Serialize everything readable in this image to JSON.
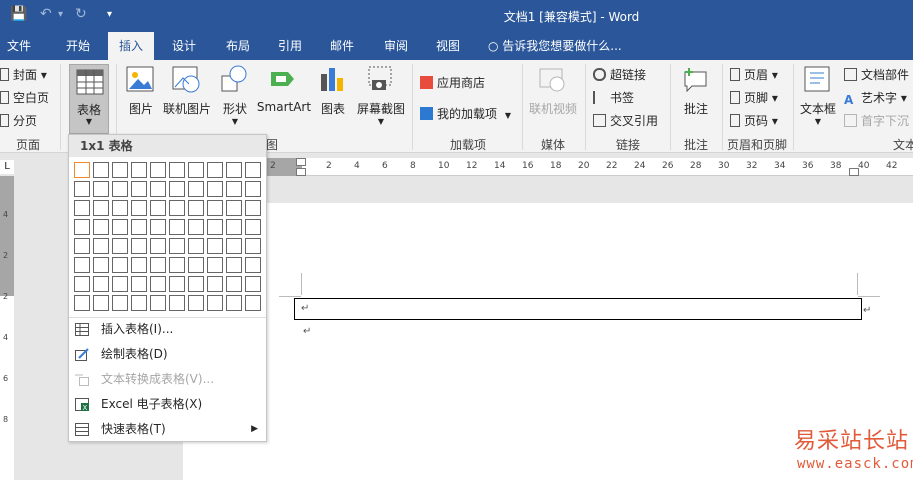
{
  "titlebar": {
    "title": "文档1 [兼容模式] - Word",
    "qat_save": "💾",
    "qat_undo": "↶",
    "qat_undo_arrow": "▾",
    "qat_redo": "↻",
    "qat_customize": "▾"
  },
  "tabs": [
    "文件",
    "开始",
    "插入",
    "设计",
    "布局",
    "引用",
    "邮件",
    "审阅",
    "视图"
  ],
  "tellme": "告诉我您想要做什么...",
  "ribbon": {
    "pages": {
      "cover": "封面",
      "blank": "空白页",
      "break": "分页",
      "label": "页面"
    },
    "table": {
      "label": "表格"
    },
    "illustrations": {
      "picture": "图片",
      "online_picture": "联机图片",
      "shapes": "形状",
      "smartart": "SmartArt",
      "chart": "图表",
      "screenshot": "屏幕截图",
      "label": "图"
    },
    "addins": {
      "store": "应用商店",
      "my_addins": "我的加载项",
      "label": "加载项"
    },
    "media": {
      "online_video": "联机视频",
      "label": "媒体"
    },
    "links": {
      "hyperlink": "超链接",
      "bookmark": "书签",
      "crossref": "交叉引用",
      "label": "链接"
    },
    "comments": {
      "comment": "批注",
      "label": "批注"
    },
    "header_footer": {
      "header": "页眉",
      "footer": "页脚",
      "page_number": "页码",
      "label": "页眉和页脚"
    },
    "text": {
      "textbox": "文本框",
      "quick_parts": "文档部件",
      "wordart": "艺术字",
      "dropcap": "首字下沉",
      "label": "文本"
    }
  },
  "ruler_numbers": [
    "2",
    "2",
    "4",
    "6",
    "8",
    "10",
    "12",
    "14",
    "16",
    "18",
    "20",
    "22",
    "24",
    "26",
    "28",
    "30",
    "32",
    "34",
    "36",
    "38",
    "40",
    "42"
  ],
  "vruler_numbers": [
    "4",
    "2",
    "2",
    "4",
    "6",
    "8"
  ],
  "document": {
    "para_mark": "↵"
  },
  "table_menu": {
    "header": "1x1 表格",
    "items": [
      {
        "label": "插入表格(I)...",
        "disabled": false
      },
      {
        "label": "绘制表格(D)",
        "disabled": false
      },
      {
        "label": "文本转换成表格(V)...",
        "disabled": true
      },
      {
        "label": "Excel 电子表格(X)",
        "disabled": false
      },
      {
        "label": "快速表格(T)",
        "disabled": false,
        "submenu_arrow": "▶"
      }
    ]
  },
  "watermark": {
    "line1": "易采站长站",
    "line2": "www.easck.com"
  },
  "colors": {
    "title_blue": "#2b579a",
    "accent_orange": "#f08a2c",
    "watermark": "#e15b3a"
  }
}
